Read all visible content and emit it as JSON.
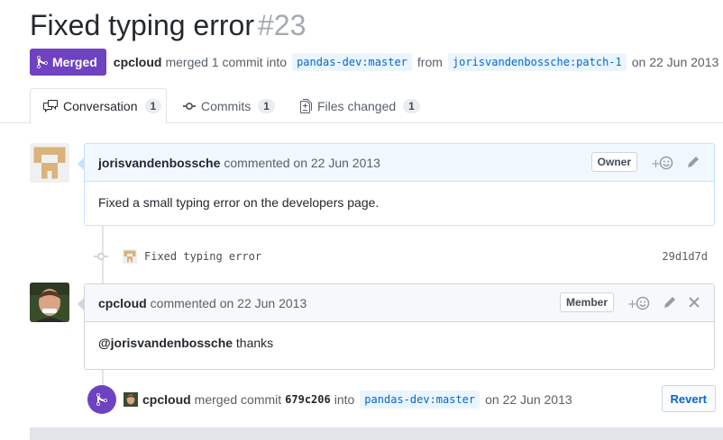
{
  "pr": {
    "title": "Fixed typing error",
    "number": "#23",
    "state_label": "Merged",
    "author": "cpcloud",
    "action_text": "merged 1 commit into",
    "base_branch": "pandas-dev:master",
    "from_text": "from",
    "head_branch": "jorisvandenbossche:patch-1",
    "date_text": "on 22 Jun 2013"
  },
  "tabs": [
    {
      "label": "Conversation",
      "count": "1",
      "icon": "comment-discussion-icon"
    },
    {
      "label": "Commits",
      "count": "1",
      "icon": "git-commit-icon"
    },
    {
      "label": "Files changed",
      "count": "1",
      "icon": "file-diff-icon"
    }
  ],
  "comments": [
    {
      "author": "jorisvandenbossche",
      "meta": "commented on 22 Jun 2013",
      "association": "Owner",
      "body": "Fixed a small typing error on the developers page."
    },
    {
      "author": "cpcloud",
      "meta": "commented on 22 Jun 2013",
      "association": "Member",
      "body_mention": "@jorisvandenbossche",
      "body_rest": " thanks"
    }
  ],
  "commit": {
    "message": "Fixed typing error",
    "sha": "29d1d7d"
  },
  "merge_event": {
    "user": "cpcloud",
    "text1": "merged commit",
    "sha": "679c206",
    "text2": "into",
    "branch": "pandas-dev:master",
    "date_text": "on 22 Jun 2013",
    "revert_label": "Revert"
  },
  "colors": {
    "merged_purple": "#6f42c1",
    "link_blue": "#0366d6"
  }
}
